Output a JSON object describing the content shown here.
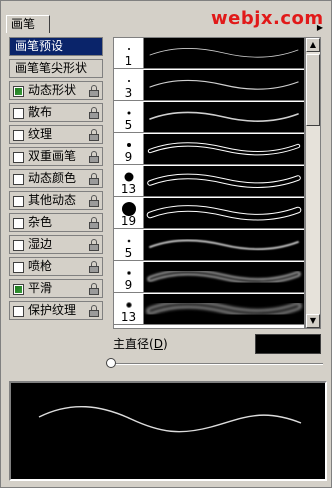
{
  "tab": {
    "label": "画笔"
  },
  "watermark": {
    "text": "webjx.com",
    "color": "#e11919"
  },
  "menu_icon": "triangle-menu-icon",
  "left_list": {
    "items": [
      {
        "label": "画笔预设",
        "checkbox": false,
        "has_checkbox": false,
        "lock": false,
        "selected": true
      },
      {
        "label": "画笔笔尖形状",
        "checkbox": false,
        "has_checkbox": false,
        "lock": false,
        "selected": false
      },
      {
        "label": "动态形状",
        "checkbox": true,
        "has_checkbox": true,
        "lock": true,
        "selected": false
      },
      {
        "label": "散布",
        "checkbox": false,
        "has_checkbox": true,
        "lock": true,
        "selected": false
      },
      {
        "label": "纹理",
        "checkbox": false,
        "has_checkbox": true,
        "lock": true,
        "selected": false
      },
      {
        "label": "双重画笔",
        "checkbox": false,
        "has_checkbox": true,
        "lock": true,
        "selected": false
      },
      {
        "label": "动态颜色",
        "checkbox": false,
        "has_checkbox": true,
        "lock": true,
        "selected": false
      },
      {
        "label": "其他动态",
        "checkbox": false,
        "has_checkbox": true,
        "lock": true,
        "selected": false
      },
      {
        "label": "杂色",
        "checkbox": false,
        "has_checkbox": true,
        "lock": true,
        "selected": false
      },
      {
        "label": "湿边",
        "checkbox": false,
        "has_checkbox": true,
        "lock": true,
        "selected": false
      },
      {
        "label": "喷枪",
        "checkbox": false,
        "has_checkbox": true,
        "lock": true,
        "selected": false
      },
      {
        "label": "平滑",
        "checkbox": true,
        "has_checkbox": true,
        "lock": true,
        "selected": false
      },
      {
        "label": "保护纹理",
        "checkbox": false,
        "has_checkbox": true,
        "lock": true,
        "selected": false
      }
    ]
  },
  "brushes": [
    {
      "size": "1",
      "soft": false,
      "selected": false
    },
    {
      "size": "3",
      "soft": false,
      "selected": false
    },
    {
      "size": "5",
      "soft": false,
      "selected": false
    },
    {
      "size": "9",
      "soft": false,
      "selected": false
    },
    {
      "size": "13",
      "soft": false,
      "selected": false
    },
    {
      "size": "19",
      "soft": false,
      "selected": false
    },
    {
      "size": "5",
      "soft": true,
      "selected": false
    },
    {
      "size": "9",
      "soft": true,
      "selected": false
    },
    {
      "size": "13",
      "soft": true,
      "selected": false
    }
  ],
  "diameter": {
    "label_prefix": "主直径(",
    "hotkey": "D",
    "label_suffix": ")",
    "value": ""
  },
  "colors": {
    "panel": "#d4d0c8",
    "selection": "#0a246a"
  }
}
